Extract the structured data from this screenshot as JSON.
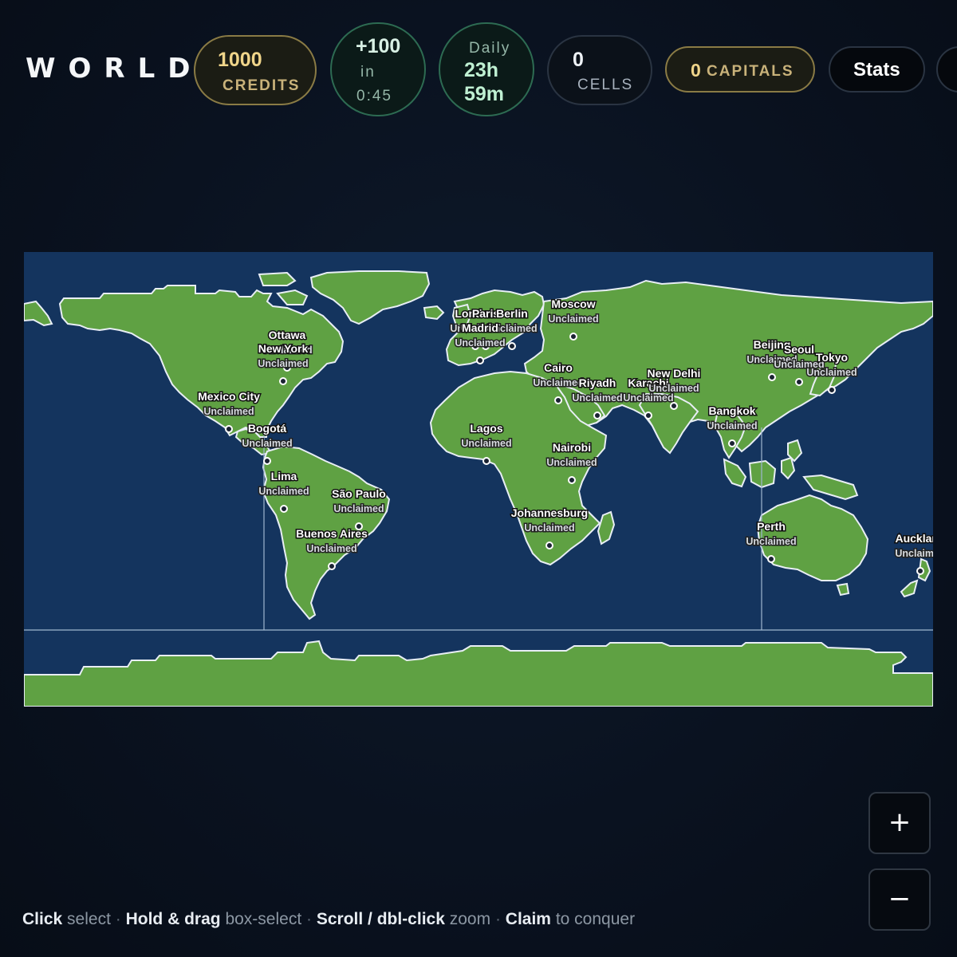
{
  "app": {
    "title": "WORLD"
  },
  "header": {
    "credits": {
      "value": "1000",
      "label": "CREDITS"
    },
    "income": {
      "amount": "+100",
      "in_label": "in",
      "countdown": "0:45"
    },
    "daily": {
      "label": "Daily",
      "hours": "23h",
      "minutes": "59m"
    },
    "cells": {
      "value": "0",
      "label": "CELLS"
    },
    "capitals": {
      "value": "0",
      "label": "CAPITALS"
    },
    "stats": {
      "label": "Stats"
    }
  },
  "map": {
    "colors": {
      "ocean": "#14345e",
      "land": "#5fa143",
      "outline": "#e8eef5",
      "grid_line": "#9fb6cf"
    },
    "cities": [
      {
        "name": "Ottawa",
        "status": "Unclaimed"
      },
      {
        "name": "New York",
        "status": "Unclaimed"
      },
      {
        "name": "Mexico City",
        "status": "Unclaimed"
      },
      {
        "name": "Bogotá",
        "status": "Unclaimed"
      },
      {
        "name": "Lima",
        "status": "Unclaimed"
      },
      {
        "name": "São Paulo",
        "status": "Unclaimed"
      },
      {
        "name": "Buenos Aires",
        "status": "Unclaimed"
      },
      {
        "name": "London",
        "status": "Unclaimed"
      },
      {
        "name": "Paris",
        "status": "Unclaimed"
      },
      {
        "name": "Berlin",
        "status": "Unclaimed"
      },
      {
        "name": "Madrid",
        "status": "Unclaimed"
      },
      {
        "name": "Moscow",
        "status": "Unclaimed"
      },
      {
        "name": "Cairo",
        "status": "Unclaimed"
      },
      {
        "name": "Riyadh",
        "status": "Unclaimed"
      },
      {
        "name": "Karachi",
        "status": "Unclaimed"
      },
      {
        "name": "New Delhi",
        "status": "Unclaimed"
      },
      {
        "name": "Lagos",
        "status": "Unclaimed"
      },
      {
        "name": "Nairobi",
        "status": "Unclaimed"
      },
      {
        "name": "Johannesburg",
        "status": "Unclaimed"
      },
      {
        "name": "Beijing",
        "status": "Unclaimed"
      },
      {
        "name": "Seoul",
        "status": "Unclaimed"
      },
      {
        "name": "Tokyo",
        "status": "Unclaimed"
      },
      {
        "name": "Bangkok",
        "status": "Unclaimed"
      },
      {
        "name": "Perth",
        "status": "Unclaimed"
      },
      {
        "name": "Auckland",
        "status": "Unclaimed"
      }
    ]
  },
  "controls": {
    "zoom_in": "+",
    "zoom_out": "−"
  },
  "hint": {
    "click": "Click",
    "click_desc": "select",
    "drag": "Hold & drag",
    "drag_desc": "box-select",
    "zoom": "Scroll / dbl-click",
    "zoom_desc": "zoom",
    "claim": "Claim",
    "claim_desc": "to conquer",
    "separator": "·"
  }
}
